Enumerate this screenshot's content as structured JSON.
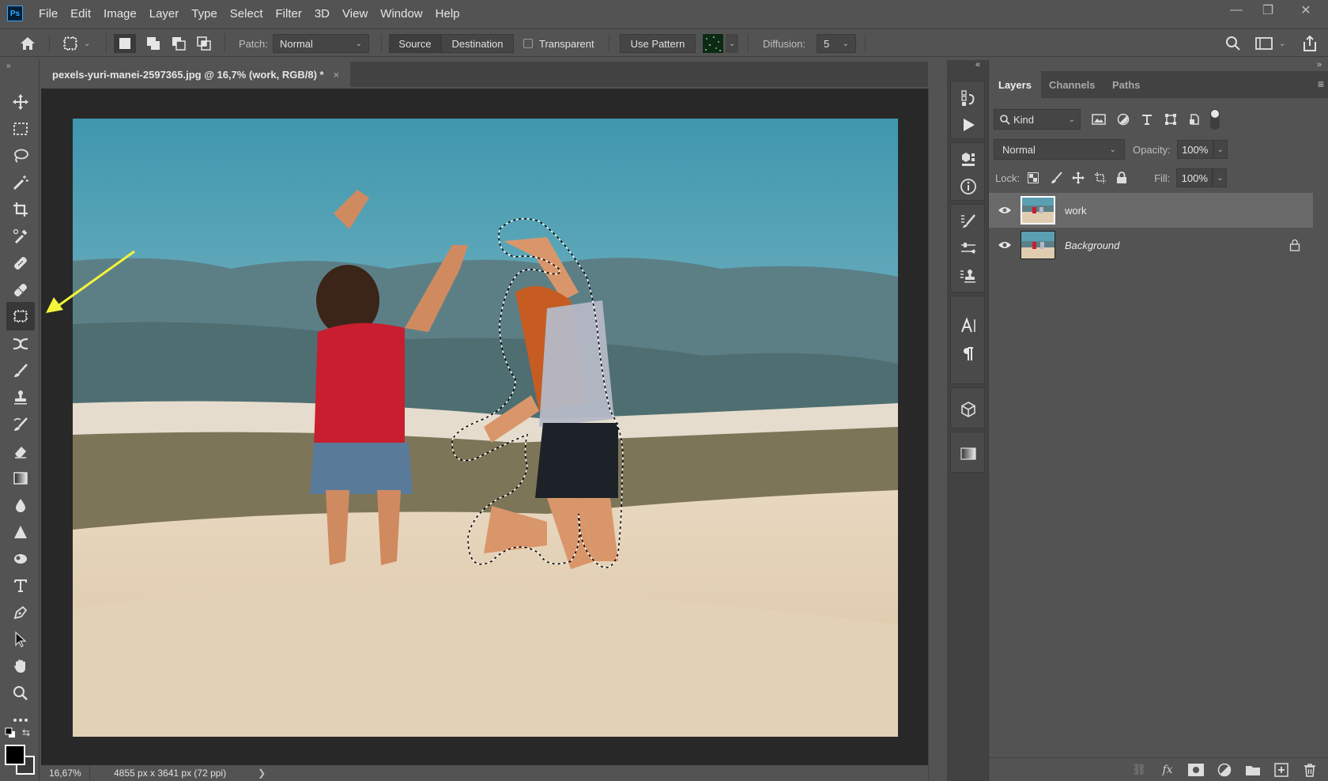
{
  "app": {
    "name": "Photoshop",
    "logo_text": "Ps"
  },
  "menu": [
    "File",
    "Edit",
    "Image",
    "Layer",
    "Type",
    "Select",
    "Filter",
    "3D",
    "View",
    "Window",
    "Help"
  ],
  "window_controls": {
    "minimize": "—",
    "restore": "❐",
    "close": "✕"
  },
  "options_bar": {
    "patch_label": "Patch:",
    "patch_value": "Normal",
    "source_label": "Source",
    "destination_label": "Destination",
    "transparent_label": "Transparent",
    "transparent_checked": false,
    "use_pattern_label": "Use Pattern",
    "diffusion_label": "Diffusion:",
    "diffusion_value": "5"
  },
  "document": {
    "tab_title": "pexels-yuri-manei-2597365.jpg @ 16,7% (work, RGB/8) *",
    "close_glyph": "×"
  },
  "tools": [
    {
      "name": "move-tool"
    },
    {
      "name": "rectangular-marquee-tool"
    },
    {
      "name": "lasso-tool"
    },
    {
      "name": "magic-wand-tool"
    },
    {
      "name": "crop-tool"
    },
    {
      "name": "eyedropper-tool"
    },
    {
      "name": "spot-healing-brush-tool"
    },
    {
      "name": "healing-brush-tool"
    },
    {
      "name": "patch-tool",
      "active": true
    },
    {
      "name": "content-aware-move-tool"
    },
    {
      "name": "brush-tool"
    },
    {
      "name": "clone-stamp-tool"
    },
    {
      "name": "history-brush-tool"
    },
    {
      "name": "eraser-tool"
    },
    {
      "name": "gradient-tool"
    },
    {
      "name": "blur-tool"
    },
    {
      "name": "sharpen-tool"
    },
    {
      "name": "dodge-tool"
    },
    {
      "name": "type-tool"
    },
    {
      "name": "pen-tool"
    },
    {
      "name": "path-selection-tool"
    },
    {
      "name": "hand-tool"
    },
    {
      "name": "zoom-tool"
    },
    {
      "name": "more-tools"
    }
  ],
  "colors": {
    "foreground": "#000000",
    "background": "#3a3a3a",
    "ui_bg": "#535353",
    "canvas_bg": "#282828",
    "annotation_arrow": "#f4f43a",
    "selected_layer": "#6a6a6a"
  },
  "status": {
    "zoom": "16,67%",
    "doc_info": "4855 px x 3641 px (72 ppi)",
    "arrow": "❯"
  },
  "layers_panel": {
    "tabs": [
      {
        "label": "Layers",
        "active": true
      },
      {
        "label": "Channels",
        "active": false
      },
      {
        "label": "Paths",
        "active": false
      }
    ],
    "filter_kind": "Kind",
    "blend_mode": "Normal",
    "opacity_label": "Opacity:",
    "opacity_value": "100%",
    "lock_label": "Lock:",
    "fill_label": "Fill:",
    "fill_value": "100%",
    "layers": [
      {
        "name": "work",
        "visible": true,
        "selected": true,
        "locked": false,
        "italic": false
      },
      {
        "name": "Background",
        "visible": true,
        "selected": false,
        "locked": true,
        "italic": true
      }
    ]
  }
}
